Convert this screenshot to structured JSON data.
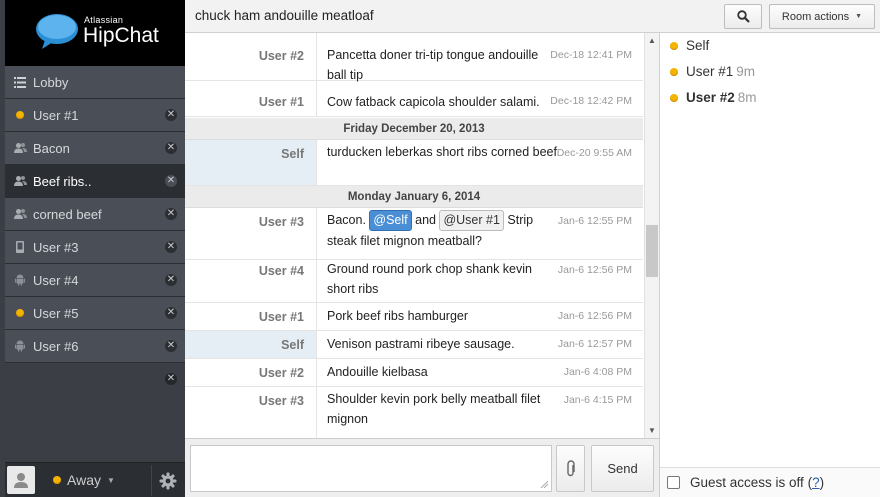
{
  "logo": {
    "small": "Atlassian",
    "big": "HipChat"
  },
  "nav": {
    "items": [
      {
        "label": "Lobby",
        "icon": "list-icon",
        "closable": false
      },
      {
        "label": "User #1",
        "icon": "status-dot-icon",
        "closable": true
      },
      {
        "label": "Bacon",
        "icon": "group-icon",
        "closable": true
      },
      {
        "label": "Beef ribs..",
        "icon": "group-icon",
        "closable": true,
        "active": true
      },
      {
        "label": "corned beef",
        "icon": "group-icon",
        "closable": true
      },
      {
        "label": "User #3",
        "icon": "mobile-icon",
        "closable": true
      },
      {
        "label": "User #4",
        "icon": "android-icon",
        "closable": true
      },
      {
        "label": "User #5",
        "icon": "status-dot-icon",
        "closable": true
      },
      {
        "label": "User #6",
        "icon": "android-icon",
        "closable": true
      }
    ]
  },
  "footer": {
    "status": "Away"
  },
  "topbar": {
    "topic": "chuck ham andouille meatloaf",
    "room_actions": "Room actions"
  },
  "messages": [
    {
      "from": "User #2",
      "text": "Pancetta doner tri-tip tongue andouille ball tip",
      "time": "Dec-18 12:41 PM"
    },
    {
      "from": "User #1",
      "text": "Cow fatback capicola shoulder salami.",
      "time": "Dec-18 12:42 PM"
    },
    {
      "date": "Friday December 20, 2013"
    },
    {
      "from": "Self",
      "text": "turducken leberkas short ribs corned beef",
      "time": "Dec-20 9:55 AM"
    },
    {
      "date": "Monday January 6, 2014"
    },
    {
      "from": "User #3",
      "text_parts": [
        "Bacon.",
        "@Self",
        "and",
        "@User #1",
        "Strip steak filet mignon meatball?"
      ],
      "time": "Jan-6 12:55 PM"
    },
    {
      "from": "User #4",
      "text": "Ground round pork chop shank kevin short ribs",
      "time": "Jan-6 12:56 PM"
    },
    {
      "from": "User #1",
      "text": "Pork beef ribs hamburger",
      "time": "Jan-6 12:56 PM"
    },
    {
      "from": "Self",
      "text": "Venison pastrami ribeye sausage.",
      "time": "Jan-6 12:57 PM"
    },
    {
      "from": "User #2",
      "text": "Andouille kielbasa",
      "time": "Jan-6 4:08 PM"
    },
    {
      "from": "User #3",
      "text": "Shoulder kevin pork belly meatball filet mignon",
      "time": "Jan-6 4:15 PM"
    }
  ],
  "compose": {
    "send_label": "Send"
  },
  "roster": [
    {
      "name": "Self",
      "idle": "",
      "bold": false
    },
    {
      "name": "User #1",
      "idle": "9m",
      "bold": false
    },
    {
      "name": "User #2",
      "idle": "8m",
      "bold": true
    }
  ],
  "guest": {
    "text": "Guest access is off",
    "help": "?"
  },
  "colors": {
    "sidebar": "#3b3f45",
    "active_nav": "#2b2e33",
    "status_away": "#f4b400",
    "mention_self": "#4a8fd6"
  }
}
